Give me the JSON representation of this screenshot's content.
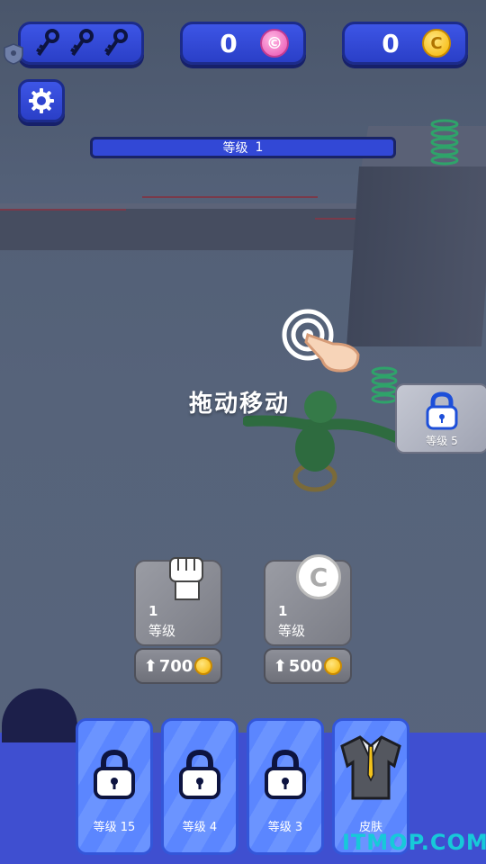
{
  "hud": {
    "keys_count_icons": [
      "key-icon",
      "key-icon",
      "key-icon"
    ],
    "gems": "0",
    "coins": "0"
  },
  "level_bar": {
    "label": "等级",
    "value": "1"
  },
  "hint": "拖动移动",
  "side_lock": {
    "label": "等级 5"
  },
  "upgrades": [
    {
      "icon": "fist-icon",
      "level": "1",
      "level_label": "等级",
      "price": "700"
    },
    {
      "icon": "coin-c-icon",
      "level": "1",
      "level_label": "等级",
      "price": "500"
    }
  ],
  "slots": [
    {
      "label": "等级 15",
      "icon": "lock-icon"
    },
    {
      "label": "等级 4",
      "icon": "lock-icon"
    },
    {
      "label": "等级 3",
      "icon": "lock-icon"
    },
    {
      "label": "皮肤",
      "icon": "suit-icon"
    }
  ],
  "watermark": "ITMOP.COM",
  "colors": {
    "hud_blue": "#2a3fc7",
    "dock": "#3f4fd0",
    "slot": "#5b86ff",
    "watermark": "#17c9d9"
  }
}
